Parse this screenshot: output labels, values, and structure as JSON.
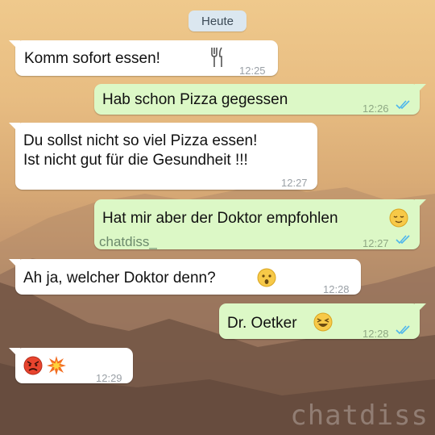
{
  "chat": {
    "date_chip": "Heute",
    "messages": [
      {
        "direction": "in",
        "text": "Komm sofort essen!",
        "emoji": "fork-knife-icon",
        "time": "12:25"
      },
      {
        "direction": "out",
        "text": "Hab schon Pizza gegessen",
        "time": "12:26",
        "status": "read"
      },
      {
        "direction": "in",
        "lines": [
          "Du sollst nicht so viel Pizza essen!",
          "Ist nicht gut für die Gesundheit !!!"
        ],
        "time": "12:27"
      },
      {
        "direction": "out",
        "text": "Hat mir aber der Doktor empfohlen",
        "emoji": "relieved-face-icon",
        "sender": "chatdiss_",
        "time": "12:27",
        "status": "read"
      },
      {
        "direction": "in",
        "text": "Ah ja, welcher Doktor denn?",
        "emoji": "hushed-face-icon",
        "time": "12:28"
      },
      {
        "direction": "out",
        "text": "Dr. Oetker",
        "emoji": "laughing-face-icon",
        "time": "12:28",
        "status": "read"
      },
      {
        "direction": "in",
        "text": "",
        "emojis": [
          "angry-face-icon",
          "collision-icon"
        ],
        "time": "12:29"
      }
    ]
  },
  "watermark": "chatdiss",
  "colors": {
    "incoming_bubble": "#ffffff",
    "outgoing_bubble": "#dcf8c6",
    "read_ticks": "#4fb6ec",
    "date_chip": "#dbe7f0"
  }
}
